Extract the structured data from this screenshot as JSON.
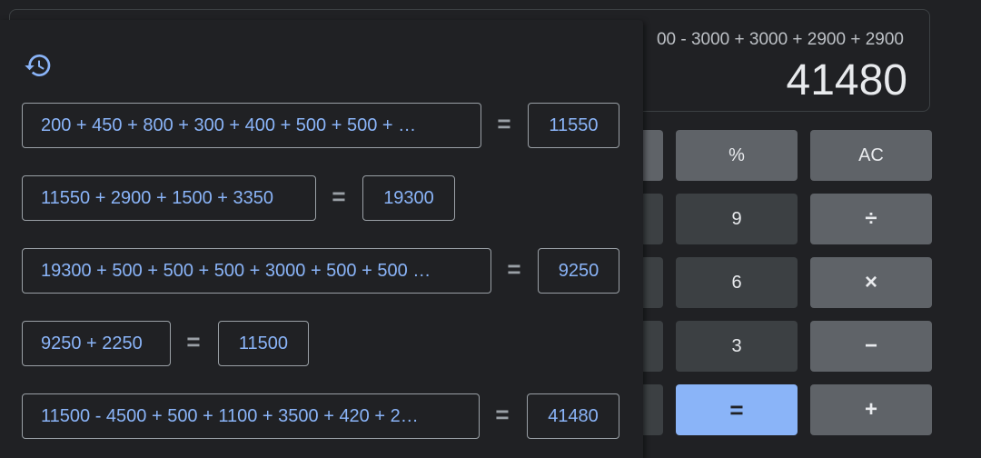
{
  "display": {
    "expression": "00 - 3000 + 3000 + 2900 + 2900",
    "result": "41480"
  },
  "keys": {
    "percent": "%",
    "clear": "AC",
    "nine": "9",
    "divide": "÷",
    "six": "6",
    "multiply": "×",
    "three": "3",
    "minus": "−",
    "equals": "=",
    "plus": "+"
  },
  "history": {
    "icon": "history-icon",
    "entries": [
      {
        "expression": "200 + 450 + 800 + 300 + 400 + 500 + 500 + …",
        "equals": "=",
        "result": "11550"
      },
      {
        "expression": "11550 + 2900 + 1500 + 3350",
        "equals": "=",
        "result": "19300"
      },
      {
        "expression": "19300 + 500 + 500 + 500 + 3000 + 500 + 500 …",
        "equals": "=",
        "result": "9250"
      },
      {
        "expression": "9250 + 2250",
        "equals": "=",
        "result": "11500"
      },
      {
        "expression": "11500 - 4500 + 500 + 1100 + 3500 + 420 + 2…",
        "equals": "=",
        "result": "41480"
      }
    ]
  },
  "colors": {
    "background": "#202124",
    "accent": "#8ab4f8",
    "key_light": "#5f6368",
    "key_dark": "#3c4043"
  }
}
